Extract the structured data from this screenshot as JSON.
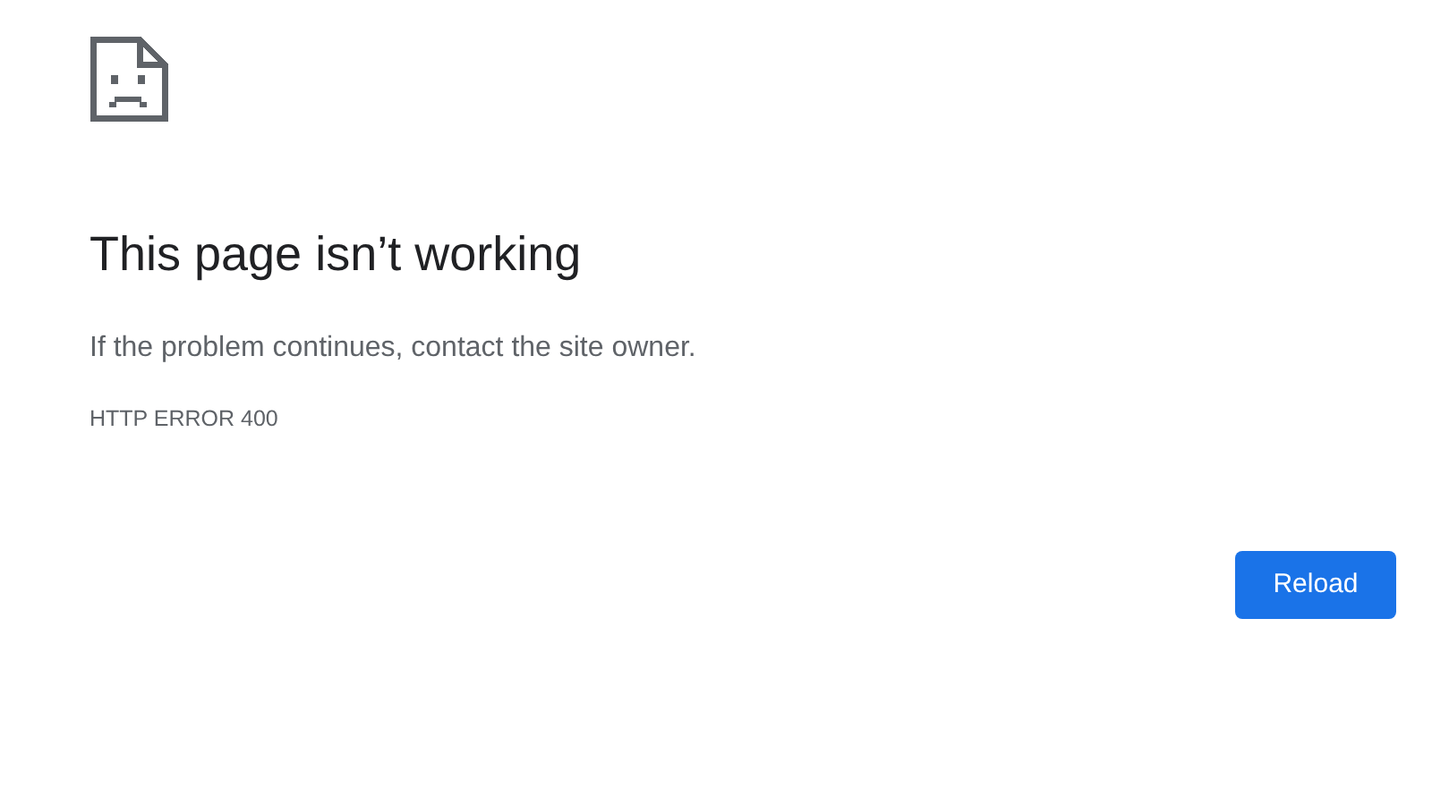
{
  "heading": "This page isn’t working",
  "message": "If the problem continues, contact the site owner.",
  "error_code": "HTTP ERROR 400",
  "buttons": [
    {
      "label": "Reload"
    }
  ]
}
